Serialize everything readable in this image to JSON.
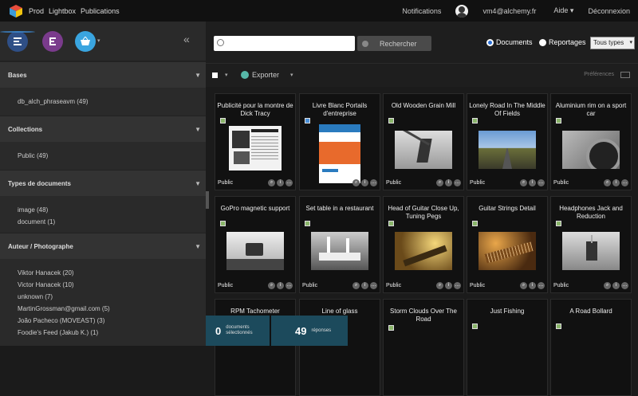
{
  "topbar": {
    "nav": [
      "Prod",
      "Lightbox",
      "Publications"
    ],
    "notifications": "Notifications",
    "user": "vm4@alchemy.fr",
    "help": "Aide ▾",
    "logout": "Déconnexion"
  },
  "sidebar": {
    "sections": [
      {
        "title": "Bases",
        "items": [
          "db_alch_phraseavm (49)"
        ]
      },
      {
        "title": "Collections",
        "items": [
          "Public (49)"
        ]
      },
      {
        "title": "Types de documents",
        "items": [
          "image (48)",
          "document (1)"
        ]
      },
      {
        "title": "Auteur / Photographe",
        "items": [
          "Viktor Hanacek (20)",
          "Victor Hanacek (10)",
          "unknown (7)",
          "MartinGrossman@gmail.com (5)",
          "João Pacheco (MOVEAST) (3)",
          "Foodie's Feed (Jakub K.) (1)"
        ]
      }
    ]
  },
  "search": {
    "placeholder": "",
    "button": "Rechercher"
  },
  "filters": {
    "documents": "Documents",
    "reportages": "Reportages",
    "type_select": "Tous types"
  },
  "subbar": {
    "export": "Exporter",
    "preferences": "Préférences"
  },
  "cards": [
    {
      "title": "Publicité pour la montre de Dick Tracy",
      "access": "Public"
    },
    {
      "title": "Livre Blanc Portails d'entreprise",
      "access": ""
    },
    {
      "title": "Old Wooden Grain Mill",
      "access": "Public"
    },
    {
      "title": "Lonely Road In The Middle Of Fields",
      "access": "Public"
    },
    {
      "title": "Aluminium rim on a sport car",
      "access": "Public"
    },
    {
      "title": "GoPro magnetic support",
      "access": "Public"
    },
    {
      "title": "Set table in a restaurant",
      "access": "Public"
    },
    {
      "title": "Head of Guitar Close Up, Tuning Pegs",
      "access": "Public"
    },
    {
      "title": "Guitar Strings Detail",
      "access": "Public"
    },
    {
      "title": "Headphones Jack and Reduction",
      "access": "Public"
    },
    {
      "title": "RPM Tachometer",
      "access": ""
    },
    {
      "title": "Line of glass",
      "access": ""
    },
    {
      "title": "Storm Clouds Over The Road",
      "access": ""
    },
    {
      "title": "Just Fishing",
      "access": ""
    },
    {
      "title": "A Road Bollard",
      "access": ""
    }
  ],
  "status": {
    "selected_count": "0",
    "selected_label": "documents sélectionnés",
    "answers_count": "49",
    "answers_label": "réponses"
  },
  "colors": {
    "accent": "#2b6fd6",
    "status_bg": "#1c4a5c"
  }
}
